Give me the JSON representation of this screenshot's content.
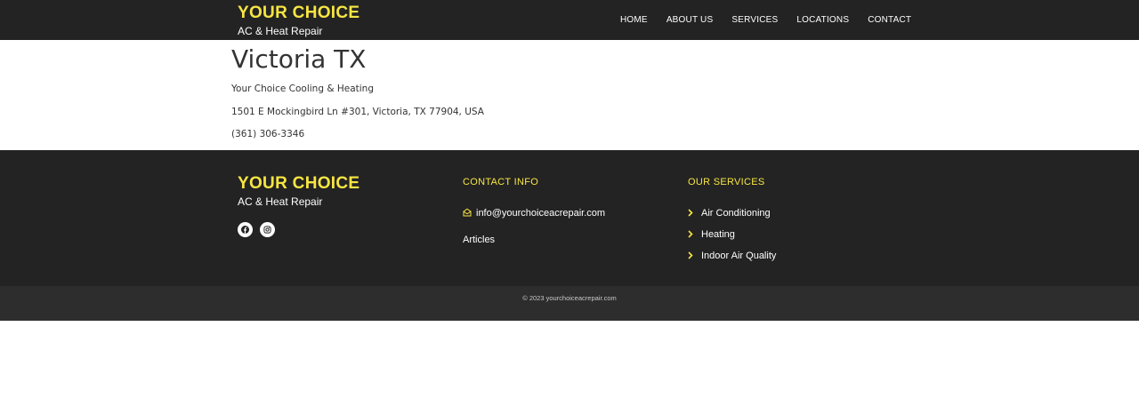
{
  "header": {
    "logo_title": "YOUR CHOICE",
    "logo_subtitle": "AC & Heat Repair",
    "nav": [
      "HOME",
      "ABOUT US",
      "SERVICES",
      "LOCATIONS",
      "CONTACT"
    ]
  },
  "main": {
    "title": "Victoria TX",
    "business_name": "Your Choice Cooling & Heating",
    "address": "1501 E Mockingbird Ln #301, Victoria, TX 77904, USA",
    "phone": "(361) 306-3346"
  },
  "footer": {
    "logo_title": "YOUR CHOICE",
    "logo_subtitle": "AC & Heat Repair",
    "social_icons": [
      "facebook-icon",
      "instagram-icon"
    ],
    "contact_heading": "CONTACT INFO",
    "email": "info@yourchoiceacrepair.com",
    "articles": "Articles",
    "services_heading": "OUR SERVICES",
    "services": [
      "Air Conditioning",
      "Heating",
      "Indoor Air Quality"
    ]
  },
  "copyright": "© 2023 yourchoiceacrepair.com",
  "colors": {
    "accent": "#f7e543",
    "dark_bg": "#232323",
    "bar_bg": "#2d2d2d",
    "text": "#333333"
  }
}
